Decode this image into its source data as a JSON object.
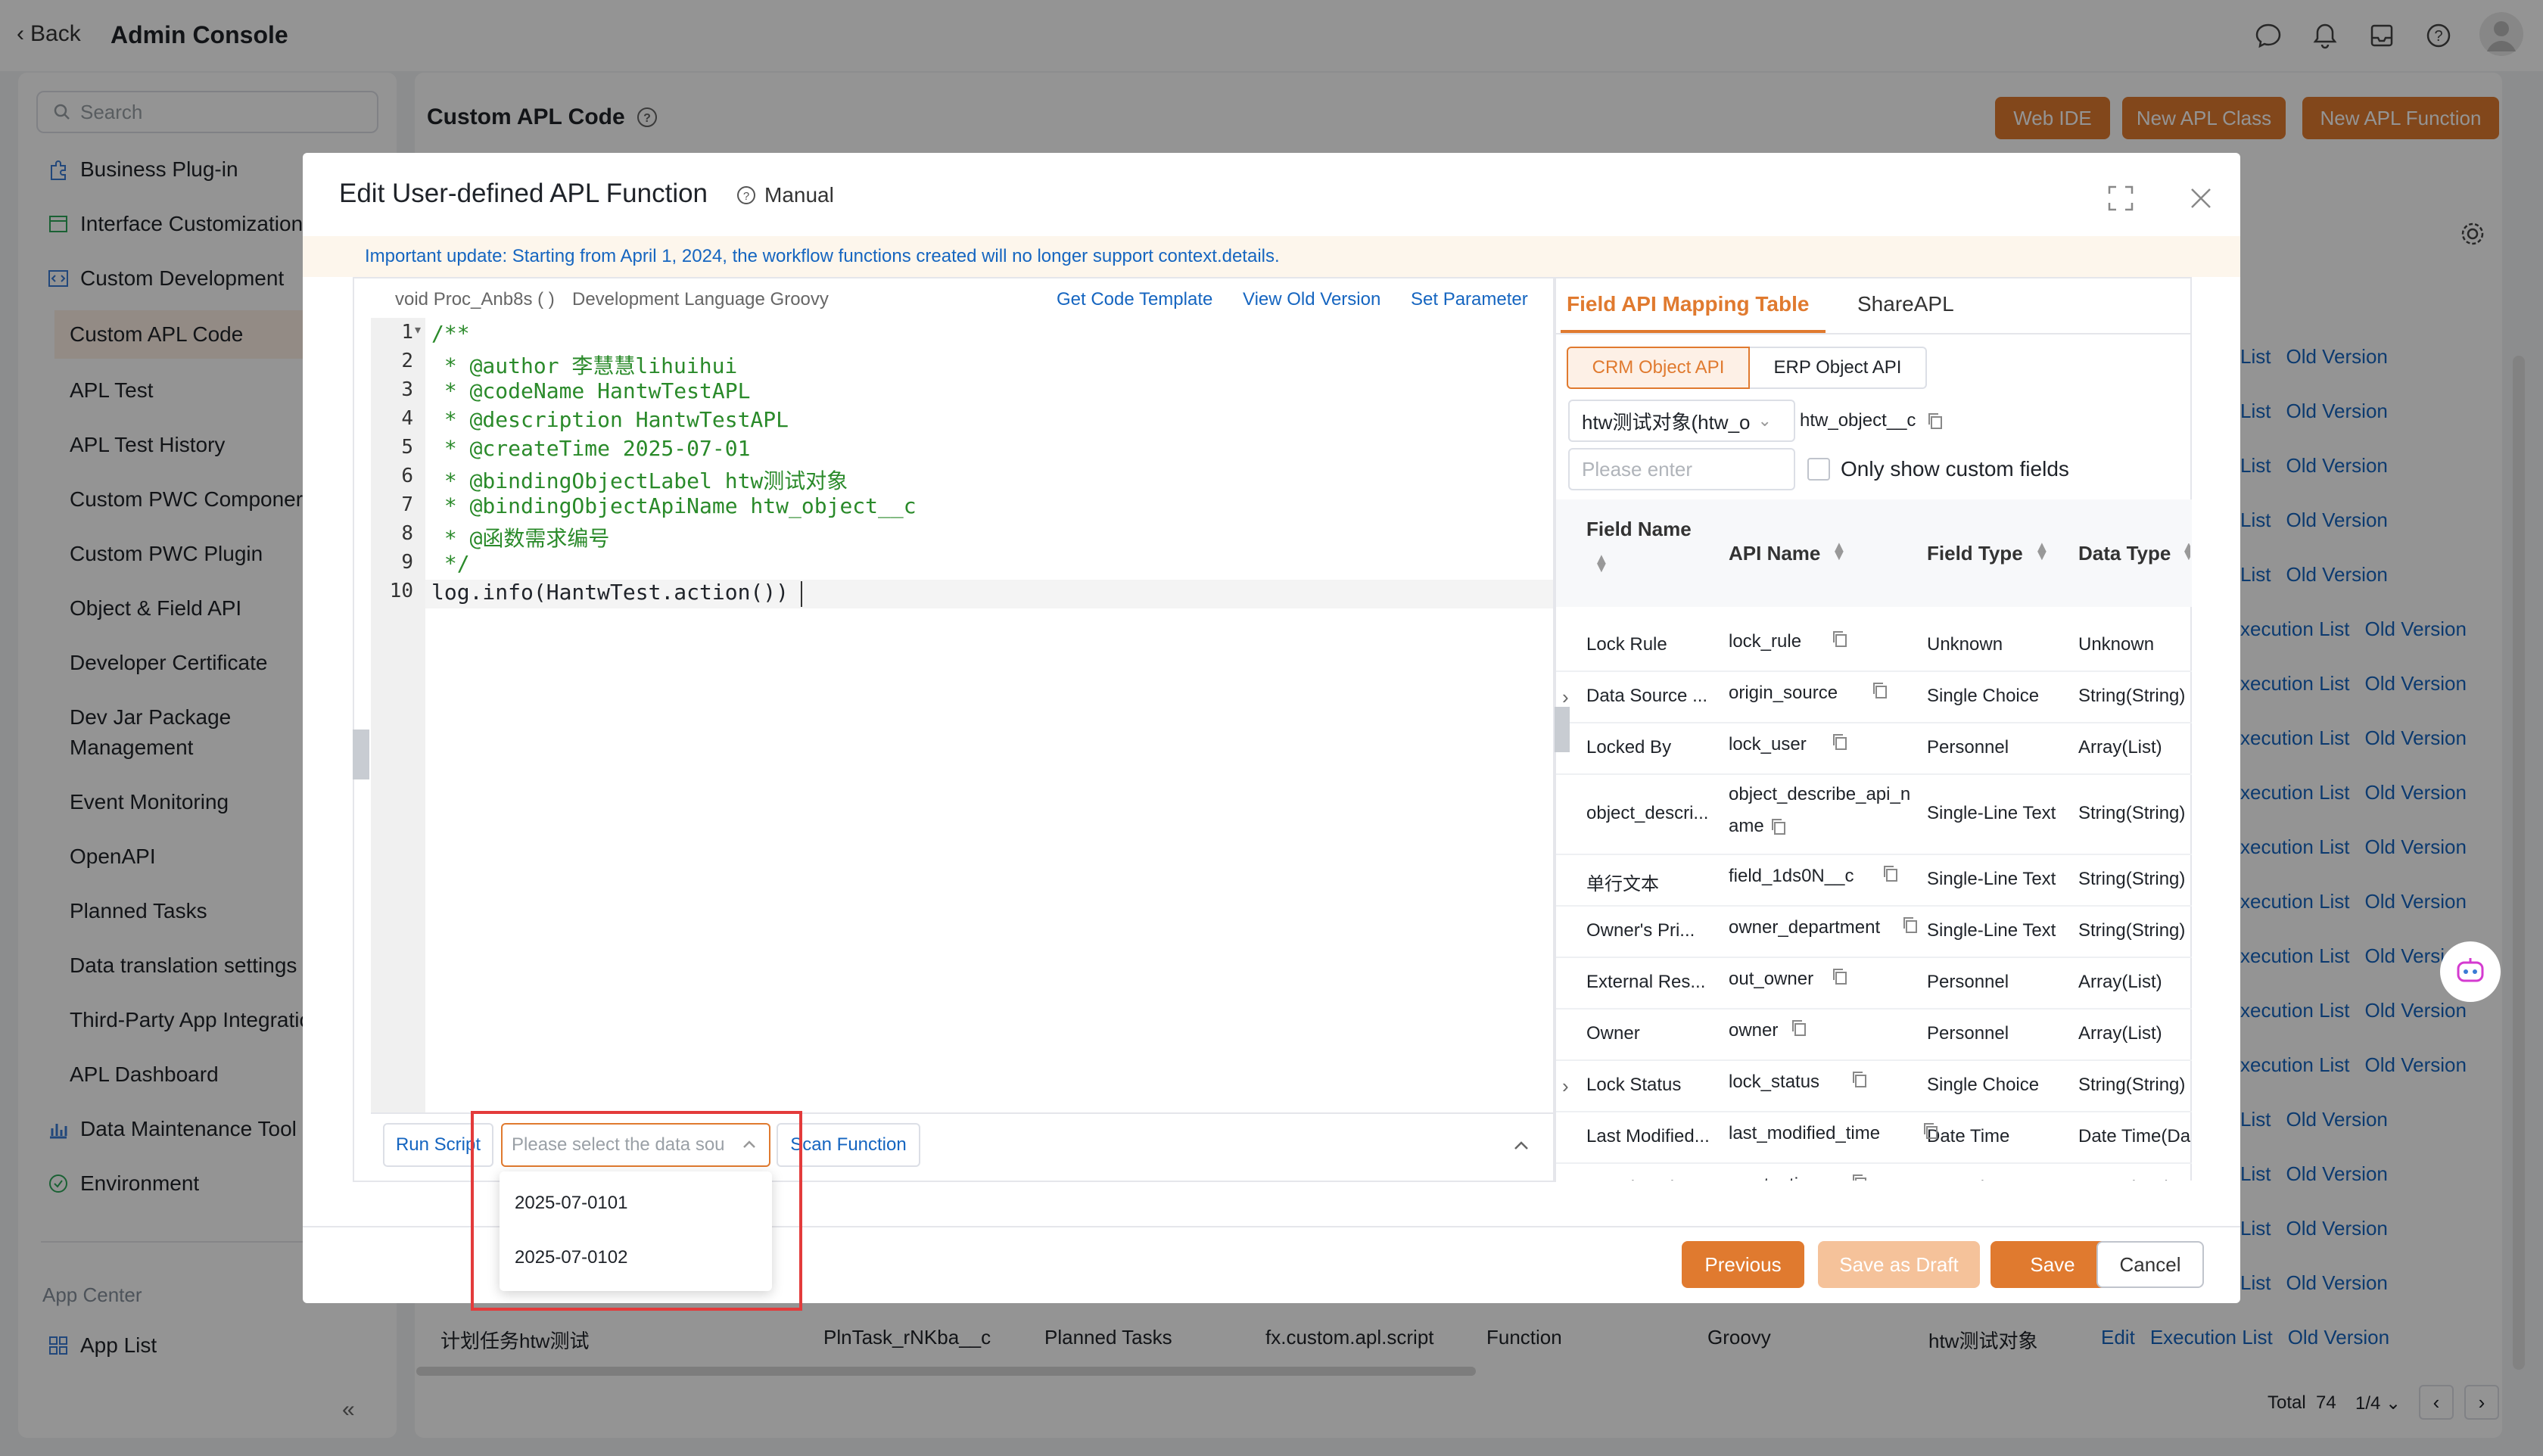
{
  "topbar": {
    "back_label": "Back",
    "title": "Admin Console"
  },
  "sidebar": {
    "search_placeholder": "Search",
    "items": [
      "Business Plug-in",
      "Interface Customization",
      "Custom Development",
      "Custom APL Code",
      "APL Test",
      "APL Test History",
      "Custom PWC Componer",
      "Custom PWC Plugin",
      "Object & Field API",
      "Developer Certificate",
      "Dev Jar Package",
      "Management",
      "Event Monitoring",
      "OpenAPI",
      "Planned Tasks",
      "Data translation settings",
      "Third-Party App Integratio",
      "APL Dashboard",
      "Data Maintenance Tool",
      "Environment"
    ],
    "app_center_label": "App Center",
    "app_list_label": "App List"
  },
  "main": {
    "title": "Custom APL Code",
    "buttons": {
      "web_ide": "Web IDE",
      "new_class": "New APL Class",
      "new_function": "New APL Function"
    },
    "row_links": {
      "list": "List",
      "execution_list": "xecution List",
      "old_version": "Old Version",
      "edit": "Edit",
      "execution_list_full": "Execution List"
    },
    "last_row": [
      "计划任务htw测试",
      "PlnTask_rNKba__c",
      "Planned Tasks",
      "fx.custom.apl.script",
      "Function",
      "Groovy",
      "htw测试对象"
    ],
    "pagination": {
      "total_label": "Total",
      "total": "74",
      "page": "1/4"
    }
  },
  "modal": {
    "title": "Edit User-defined APL Function",
    "manual_label": "Manual",
    "notice": "Important update: Starting from April 1, 2024, the workflow functions created will no longer support context.details.",
    "editor": {
      "signature": "void Proc_Anb8s ( )",
      "language": "Development Language Groovy",
      "links": {
        "template": "Get Code Template",
        "old_version": "View Old Version",
        "set_param": "Set Parameter"
      },
      "line_numbers": [
        "1",
        "2",
        "3",
        "4",
        "5",
        "6",
        "7",
        "8",
        "9",
        "10"
      ],
      "lines": [
        "/**",
        " * @author 李慧慧lihuihui",
        " * @codeName HantwTestAPL",
        " * @description HantwTestAPL",
        " * @createTime 2025-07-01",
        " * @bindingObjectLabel htw测试对象",
        " * @bindingObjectApiName htw_object__c",
        " * @函数需求编号",
        " */",
        "log.info(HantwTest.action())"
      ],
      "run_script": "Run Script",
      "scan_function": "Scan Function",
      "datasource_placeholder": "Please select the data sou",
      "datasource_options": [
        "2025-07-0101",
        "2025-07-0102"
      ]
    },
    "field_panel": {
      "tab_mapping": "Field API Mapping Table",
      "tab_share": "ShareAPL",
      "sub_crm": "CRM Object API",
      "sub_erp": "ERP Object API",
      "object_select": "htw测试对象(htw_o",
      "object_api": "htw_object__c",
      "filter_placeholder": "Please enter",
      "only_custom": "Only show custom fields",
      "headers": {
        "field_name": "Field Name",
        "api_name": "API Name",
        "field_type": "Field Type",
        "data_type": "Data Type"
      },
      "rows": [
        {
          "name": "Lock Rule",
          "api": "lock_rule",
          "ftype": "Unknown",
          "dtype": "Unknown"
        },
        {
          "name": "Data Source ...",
          "api": "origin_source",
          "ftype": "Single Choice",
          "dtype": "String(String)"
        },
        {
          "name": "Locked By",
          "api": "lock_user",
          "ftype": "Personnel",
          "dtype": "Array(List)"
        },
        {
          "name": "object_descri...",
          "api": "object_describe_api_n",
          "api2": "ame",
          "ftype": "Single-Line Text",
          "dtype": "String(String)"
        },
        {
          "name": "单行文本",
          "api": "field_1ds0N__c",
          "ftype": "Single-Line Text",
          "dtype": "String(String)"
        },
        {
          "name": "Owner's Pri...",
          "api": "owner_department",
          "ftype": "Single-Line Text",
          "dtype": "String(String)"
        },
        {
          "name": "External Res...",
          "api": "out_owner",
          "ftype": "Personnel",
          "dtype": "Array(List)"
        },
        {
          "name": "Owner",
          "api": "owner",
          "ftype": "Personnel",
          "dtype": "Array(List)"
        },
        {
          "name": "Lock Status",
          "api": "lock_status",
          "ftype": "Single Choice",
          "dtype": "String(String)"
        },
        {
          "name": "Last Modified...",
          "api": "last_modified_time",
          "ftype": "Date Time",
          "dtype": "Date Time(Da"
        },
        {
          "name": "Creation Time",
          "api": "create_time",
          "ftype": "Date Time",
          "dtype": "Date Time(Da"
        }
      ]
    },
    "footer": {
      "previous": "Previous",
      "save_draft": "Save as Draft",
      "save": "Save",
      "cancel": "Cancel"
    }
  },
  "colors": {
    "accent": "#e07a2f",
    "link": "#1565c0",
    "highlight_box": "#e33b3b"
  }
}
